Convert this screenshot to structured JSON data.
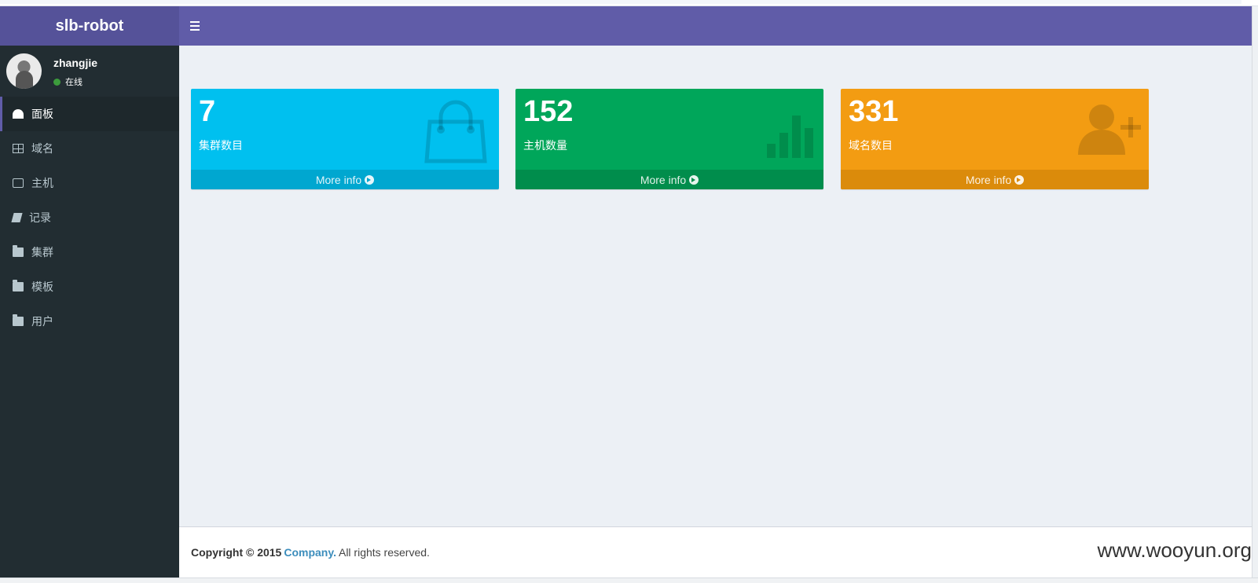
{
  "app": {
    "brand": "slb-robot"
  },
  "user": {
    "name": "zhangjie",
    "status": "在线"
  },
  "sidebar": {
    "items": [
      {
        "label": "面板",
        "icon": "dashboard-icon",
        "active": true
      },
      {
        "label": "域名",
        "icon": "table-icon"
      },
      {
        "label": "主机",
        "icon": "edit-icon"
      },
      {
        "label": "记录",
        "icon": "book-icon"
      },
      {
        "label": "集群",
        "icon": "folder-icon"
      },
      {
        "label": "模板",
        "icon": "folder-icon"
      },
      {
        "label": "用户",
        "icon": "folder-icon"
      }
    ]
  },
  "boxes": [
    {
      "value": "7",
      "label": "集群数目",
      "link": "More info",
      "icon": "shopping-bag-icon",
      "color": "#00c0ef"
    },
    {
      "value": "152",
      "label": "主机数量",
      "link": "More info",
      "icon": "bar-chart-icon",
      "color": "#00a65a"
    },
    {
      "value": "331",
      "label": "域名数目",
      "link": "More info",
      "icon": "user-add-icon",
      "color": "#f39c12"
    }
  ],
  "footer": {
    "copyright": "Copyright © 2015",
    "company": "Company.",
    "rights": "All rights reserved."
  },
  "watermark": "www.wooyun.org",
  "colors": {
    "header": "#605ca8",
    "brand": "#555299",
    "sidebar": "#222d32"
  }
}
